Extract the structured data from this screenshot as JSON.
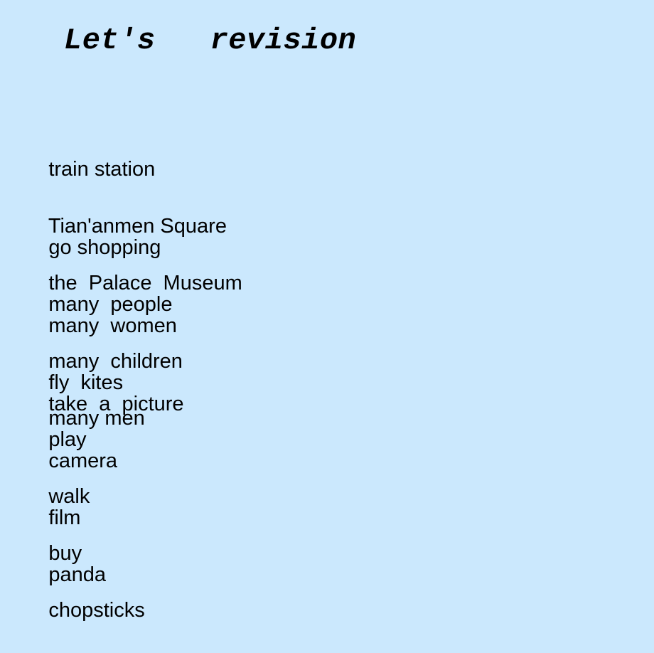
{
  "slide": {
    "background_color": "#cbe8fd",
    "text_color": "#000000",
    "title": "Let's   revision"
  },
  "rows": [
    {
      "id": "row-1",
      "items": [
        {
          "text": "train station"
        },
        {
          "text": "Tian'anmen Square"
        },
        {
          "text": "the  Palace  Museum"
        }
      ]
    },
    {
      "id": "row-2",
      "items": [
        {
          "text": "go shopping"
        },
        {
          "text": "many  people"
        },
        {
          "text": "many  children"
        },
        {
          "text": "many men"
        }
      ]
    },
    {
      "id": "row-3",
      "items": [
        {
          "text": "many  women"
        },
        {
          "text": "fly  kites"
        },
        {
          "text": "play"
        },
        {
          "text": "walk"
        },
        {
          "text": "buy"
        },
        {
          "text": "chopsticks"
        }
      ]
    },
    {
      "id": "row-4",
      "items": [
        {
          "text": "take  a  picture"
        },
        {
          "text": "camera"
        },
        {
          "text": "film"
        },
        {
          "text": "panda"
        }
      ]
    }
  ]
}
